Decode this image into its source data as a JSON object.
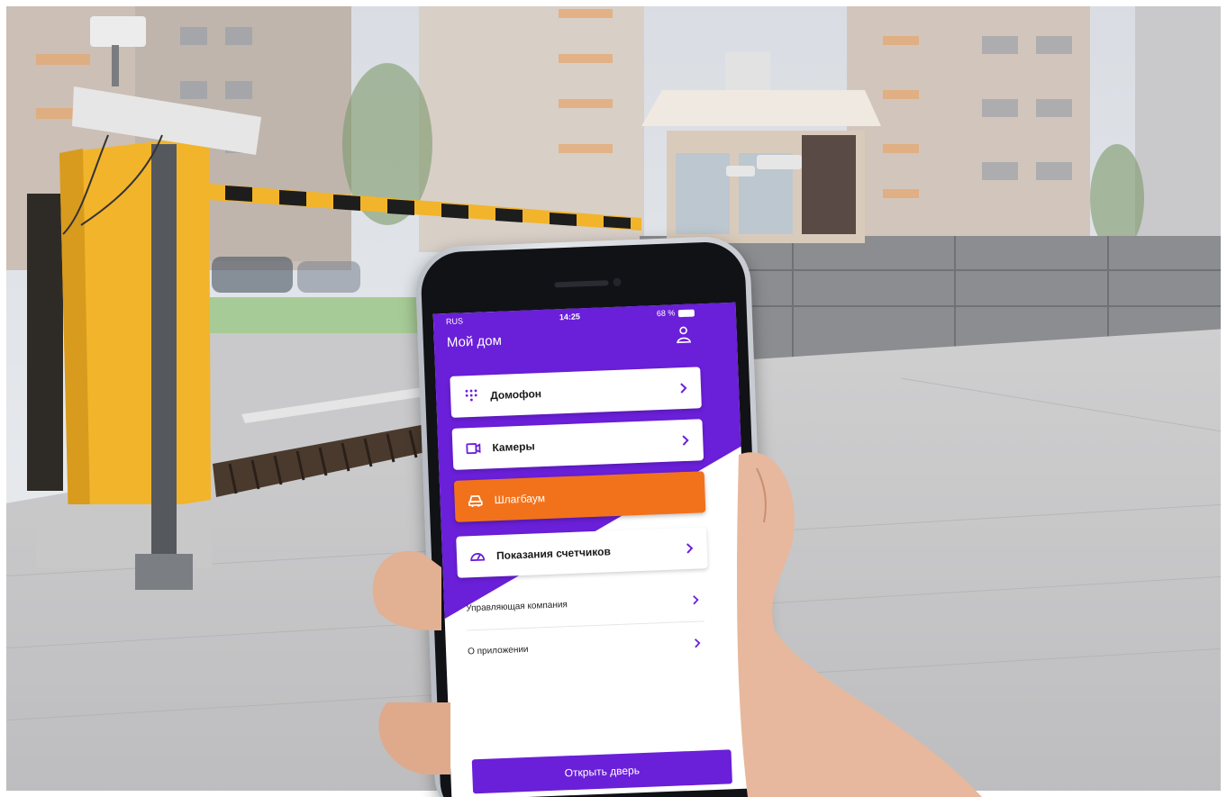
{
  "status_bar": {
    "carrier": "RUS",
    "time": "14:25",
    "battery": "68 %"
  },
  "app": {
    "title": "Мой дом"
  },
  "menu_cards": [
    {
      "label": "Домофон",
      "icon": "dialpad-icon"
    },
    {
      "label": "Камеры",
      "icon": "camera-icon"
    },
    {
      "label": "Шлагбаум",
      "icon": "car-icon"
    },
    {
      "label": "Показания счетчиков",
      "icon": "gauge-icon"
    }
  ],
  "plain_items": [
    {
      "label": "Управляющая компания"
    },
    {
      "label": "О приложении"
    }
  ],
  "primary_button": {
    "label": "Открыть дверь"
  },
  "colors": {
    "brand_purple": "#6a1fd8",
    "active_orange": "#f2721c",
    "barrier_yellow": "#f2b42a"
  }
}
